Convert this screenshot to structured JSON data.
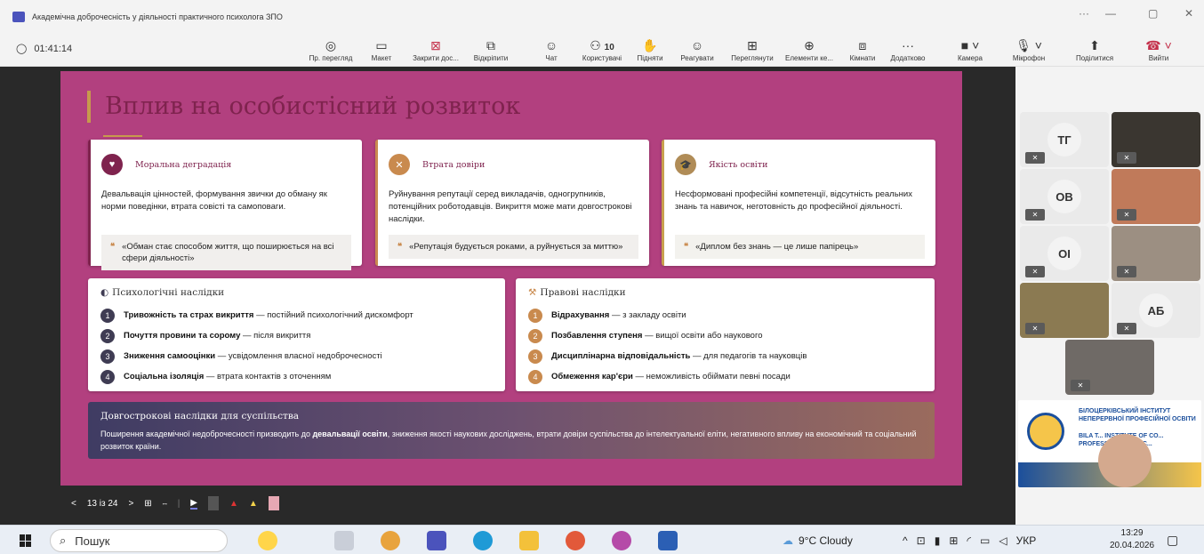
{
  "window": {
    "title": "Академічна доброчесність у діяльності практичного психолога ЗПО",
    "more": "···",
    "minimize": "—",
    "restore": "▢",
    "close": "✕"
  },
  "toolbar": {
    "timer": "01:41:14",
    "buttons": [
      {
        "label": "Пр. перегляд",
        "icon": "eye-icon"
      },
      {
        "label": "Макет",
        "icon": "layout-icon"
      },
      {
        "label": "Закрити дос...",
        "icon": "close-share-icon"
      },
      {
        "label": "Відкріпити",
        "icon": "unpin-icon"
      },
      {
        "label": "Чат",
        "icon": "chat-icon"
      },
      {
        "label": "Користувачі",
        "icon": "people-icon",
        "count": "10"
      },
      {
        "label": "Підняти",
        "icon": "raise-hand-icon"
      },
      {
        "label": "Реагувати",
        "icon": "smile-icon"
      },
      {
        "label": "Переглянути",
        "icon": "view-icon"
      },
      {
        "label": "Елементи ке...",
        "icon": "apps-icon"
      },
      {
        "label": "Кімнати",
        "icon": "rooms-icon"
      },
      {
        "label": "Додатково",
        "icon": "more-icon"
      },
      {
        "label": "Камера",
        "icon": "camera-icon"
      },
      {
        "label": "Мікрофон",
        "icon": "mic-icon"
      },
      {
        "label": "Поділитися",
        "icon": "share-icon"
      },
      {
        "label": "Вийти",
        "icon": "hangup-icon"
      }
    ]
  },
  "slide": {
    "title": "Вплив на особистісний розвиток",
    "cards": [
      {
        "title": "Моральна деградація",
        "text": "Девальвація цінностей, формування звички до обману як норми поведінки, втрата совісті та самоповаги.",
        "quote": "«Обман стає способом життя, що поширюється на всі сфери діяльності»"
      },
      {
        "title": "Втрата довіри",
        "text": "Руйнування репутації серед викладачів, одногрупників, потенційних роботодавців. Викриття може мати довгострокові наслідки.",
        "quote": "«Репутація будується роками, а руйнується за миттю»"
      },
      {
        "title": "Якість освіти",
        "text": "Несформовані професійні компетенції, відсутність реальних знань та навичок, неготовність до професійної діяльності.",
        "quote": "«Диплом без знань — це лише папірець»"
      }
    ],
    "psych": {
      "title": "Психологічні наслідки",
      "items": [
        {
          "n": "1",
          "bold": "Тривожність та страх викриття",
          "rest": " — постійний психологічний дискомфорт"
        },
        {
          "n": "2",
          "bold": "Почуття провини та сорому",
          "rest": " — після викриття"
        },
        {
          "n": "3",
          "bold": "Зниження самооцінки",
          "rest": " — усвідомлення власної недоброчесності"
        },
        {
          "n": "4",
          "bold": "Соціальна ізоляція",
          "rest": " — втрата контактів з оточенням"
        }
      ]
    },
    "legal": {
      "title": "Правові наслідки",
      "items": [
        {
          "n": "1",
          "bold": "Відрахування",
          "rest": " — з закладу освіти"
        },
        {
          "n": "2",
          "bold": "Позбавлення ступеня",
          "rest": " — вищої освіти або наукового"
        },
        {
          "n": "3",
          "bold": "Дисциплінарна відповідальність",
          "rest": " — для педагогів та науковців"
        },
        {
          "n": "4",
          "bold": "Обмеження кар'єри",
          "rest": " — неможливість обіймати певні посади"
        }
      ]
    },
    "society": {
      "title": "Довгострокові наслідки для суспільства",
      "text_a": "Поширення академічної недоброчесності призводить до ",
      "text_bold": "девальвації освіти",
      "text_b": ", зниження якості наукових досліджень, втрати довіри суспільства до інтелектуальної еліти, негативного впливу на економічний та соціальний розвиток країни."
    }
  },
  "slide_nav": {
    "prev": "<",
    "page": "13 із 24",
    "next": ">"
  },
  "participants": [
    {
      "initials": "ТГ"
    },
    {
      "initials": "ОВ"
    },
    {
      "initials": "ОІ"
    },
    {
      "initials": "АБ"
    }
  ],
  "banner": {
    "line1": "БІЛОЦЕРКІВСЬКИЙ ІНСТИТУТ НЕПЕРЕРВНОЇ ПРОФЕСІЙНОЇ ОСВІТИ",
    "line2": "BILA T... INSTITUTE OF CO... PROFESSIONAL EDUC..."
  },
  "taskbar": {
    "search": "Пошук",
    "weather": "9°C Cloudy",
    "lang": "УКР",
    "time": "13:29",
    "date": "20.04.2026"
  }
}
